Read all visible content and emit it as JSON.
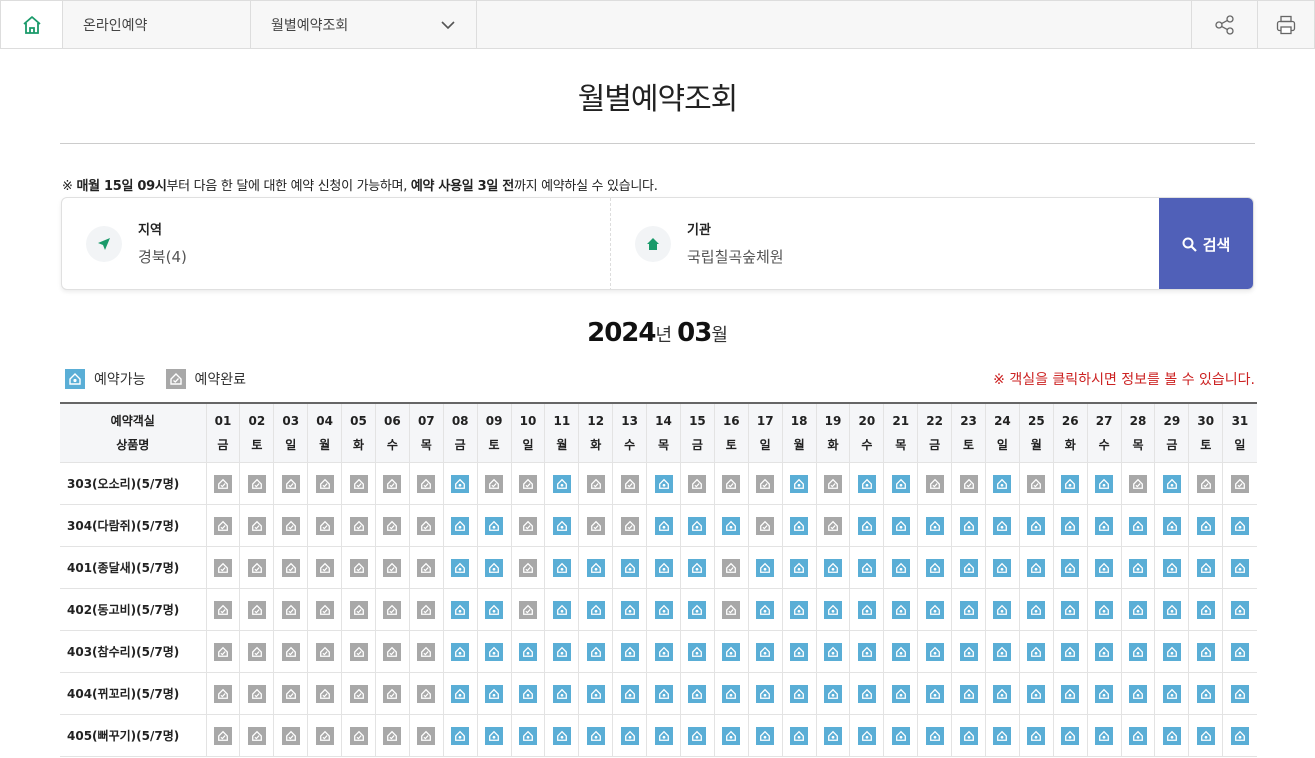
{
  "topbar": {
    "crumb1": "온라인예약",
    "crumb2": "월별예약조회"
  },
  "page": {
    "title": "월별예약조회"
  },
  "notice": {
    "prefix": "※ ",
    "b1": "매월 15일 09시",
    "t1": "부터 다음 한 달에 대한 예약 신청이 가능하며, ",
    "b2": "예약 사용일 3일 전",
    "t2": "까지 예약하실 수 있습니다."
  },
  "search": {
    "region_label": "지역",
    "region_value": "경북(4)",
    "facility_label": "기관",
    "facility_value": "국립칠곡숲체원",
    "button_label": "검색"
  },
  "month": {
    "year": "2024",
    "year_unit": "년",
    "month": "03",
    "month_unit": "월"
  },
  "legend": {
    "available": "예약가능",
    "completed": "예약완료"
  },
  "hint": "※ 객실을 클릭하시면 정보를 볼 수 있습니다.",
  "colors": {
    "available": "#5aaed6",
    "completed": "#a8a8a8",
    "search_button": "#5060b8",
    "hint": "#cc2222"
  },
  "table": {
    "header_line1": "예약객실",
    "header_line2": "상품명",
    "days": [
      {
        "d": "01",
        "w": "금"
      },
      {
        "d": "02",
        "w": "토"
      },
      {
        "d": "03",
        "w": "일"
      },
      {
        "d": "04",
        "w": "월"
      },
      {
        "d": "05",
        "w": "화"
      },
      {
        "d": "06",
        "w": "수"
      },
      {
        "d": "07",
        "w": "목"
      },
      {
        "d": "08",
        "w": "금"
      },
      {
        "d": "09",
        "w": "토"
      },
      {
        "d": "10",
        "w": "일"
      },
      {
        "d": "11",
        "w": "월"
      },
      {
        "d": "12",
        "w": "화"
      },
      {
        "d": "13",
        "w": "수"
      },
      {
        "d": "14",
        "w": "목"
      },
      {
        "d": "15",
        "w": "금"
      },
      {
        "d": "16",
        "w": "토"
      },
      {
        "d": "17",
        "w": "일"
      },
      {
        "d": "18",
        "w": "월"
      },
      {
        "d": "19",
        "w": "화"
      },
      {
        "d": "20",
        "w": "수"
      },
      {
        "d": "21",
        "w": "목"
      },
      {
        "d": "22",
        "w": "금"
      },
      {
        "d": "23",
        "w": "토"
      },
      {
        "d": "24",
        "w": "일"
      },
      {
        "d": "25",
        "w": "월"
      },
      {
        "d": "26",
        "w": "화"
      },
      {
        "d": "27",
        "w": "수"
      },
      {
        "d": "28",
        "w": "목"
      },
      {
        "d": "29",
        "w": "금"
      },
      {
        "d": "30",
        "w": "토"
      },
      {
        "d": "31",
        "w": "일"
      }
    ],
    "rooms": [
      {
        "name": "303(오소리)(5/7명)",
        "avail": "0000000100100100010110010110100"
      },
      {
        "name": "304(다람쥐)(5/7명)",
        "avail": "0000000110100111010111111111111"
      },
      {
        "name": "401(종달새)(5/7명)",
        "avail": "0000000110111110111111111111111"
      },
      {
        "name": "402(동고비)(5/7명)",
        "avail": "0000000110111110111111111111111"
      },
      {
        "name": "403(참수리)(5/7명)",
        "avail": "0000000111111111111111111111111"
      },
      {
        "name": "404(뀌꼬리)(5/7명)",
        "avail": "0000000111111111111111111111111"
      },
      {
        "name": "405(뻐꾸기)(5/7명)",
        "avail": "0000000111111111111111111111111"
      }
    ]
  }
}
